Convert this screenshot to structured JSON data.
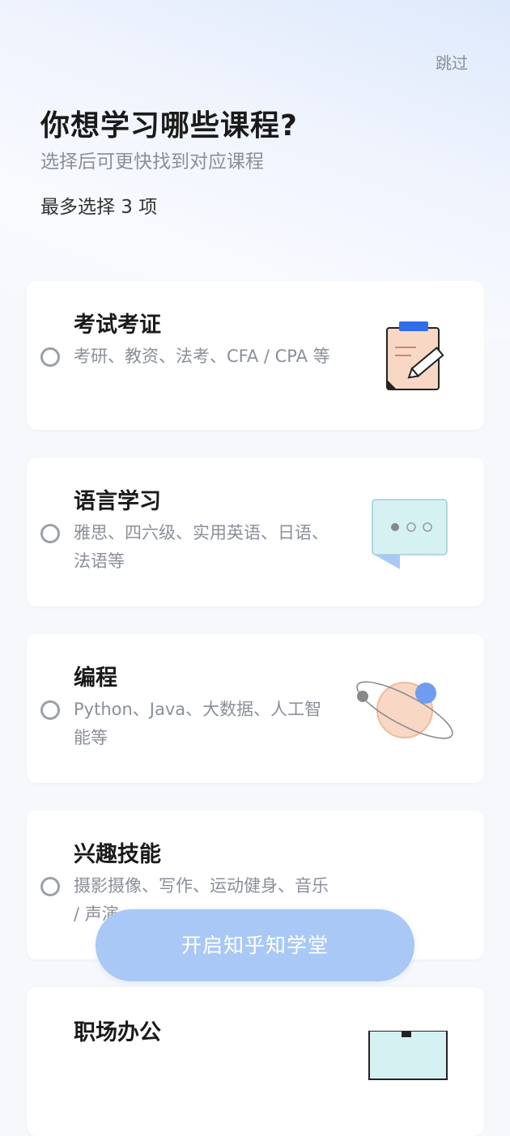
{
  "header": {
    "skip_label": "跳过",
    "title": "你想学习哪些课程?",
    "subtitle": "选择后可更快找到对应课程",
    "limit_text": "最多选择 3 项"
  },
  "courses": [
    {
      "title": "考试考证",
      "desc": "考研、教资、法考、CFA / CPA 等",
      "icon": "clipboard-pencil-icon",
      "selected": false
    },
    {
      "title": "语言学习",
      "desc": "雅思、四六级、实用英语、日语、法语等",
      "icon": "chat-bubble-icon",
      "selected": false
    },
    {
      "title": "编程",
      "desc": "Python、Java、大数据、人工智能等",
      "icon": "planet-orbit-icon",
      "selected": false
    },
    {
      "title": "兴趣技能",
      "desc": "摄影摄像、写作、运动健身、音乐 / 声演",
      "icon": "interest-icon",
      "selected": false
    },
    {
      "title": "职场办公",
      "desc": "",
      "icon": "office-icon",
      "selected": false
    }
  ],
  "cta_label": "开启知乎知学堂",
  "colors": {
    "accent": "#a9c8f6",
    "text_primary": "#1a1a1a",
    "text_secondary": "#8a8f99"
  }
}
